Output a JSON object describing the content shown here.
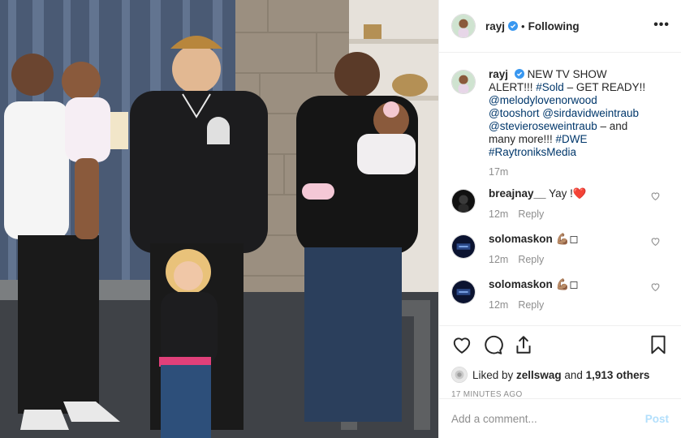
{
  "post": {
    "username": "rayj",
    "separator": "•",
    "following_label": "Following",
    "more_label": "•••"
  },
  "caption": {
    "username": "rayj",
    "text": "NEW TV SHOW ALERT!!! ",
    "tag_sold": "#Sold",
    "text2": " – GET READY!! ",
    "mention1": "@melodylovenorwood",
    "mention2": "@tooshort",
    "mention3": "@sirdavidweintraub",
    "mention4": "@stevieroseweintraub",
    "text3": " – and many more!!! ",
    "tag_dwe": "#DWE",
    "tag_ray": "#RaytroniksMedia",
    "time": "17m"
  },
  "comments": [
    {
      "username": "breajnay__",
      "text": "Yay !❤️",
      "time": "12m",
      "reply": "Reply"
    },
    {
      "username": "solomaskon",
      "text": "💪🏽◻",
      "time": "12m",
      "reply": "Reply"
    },
    {
      "username": "solomaskon",
      "text": "💪🏽◻",
      "time": "12m",
      "reply": "Reply"
    }
  ],
  "likes": {
    "prefix": "Liked by ",
    "user": "zellswag",
    "middle": " and ",
    "count": "1,913 others"
  },
  "timestamp": "17 MINUTES AGO",
  "add_comment": {
    "placeholder": "Add a comment...",
    "post_label": "Post"
  },
  "icons": [
    "heart-icon",
    "comment-icon",
    "share-icon",
    "bookmark-icon",
    "verified-badge-icon",
    "more-options-icon"
  ],
  "colors": {
    "link": "#00376b",
    "meta": "#8e8e8e",
    "post_disabled": "#b2dffc",
    "verified": "#3897f0"
  }
}
